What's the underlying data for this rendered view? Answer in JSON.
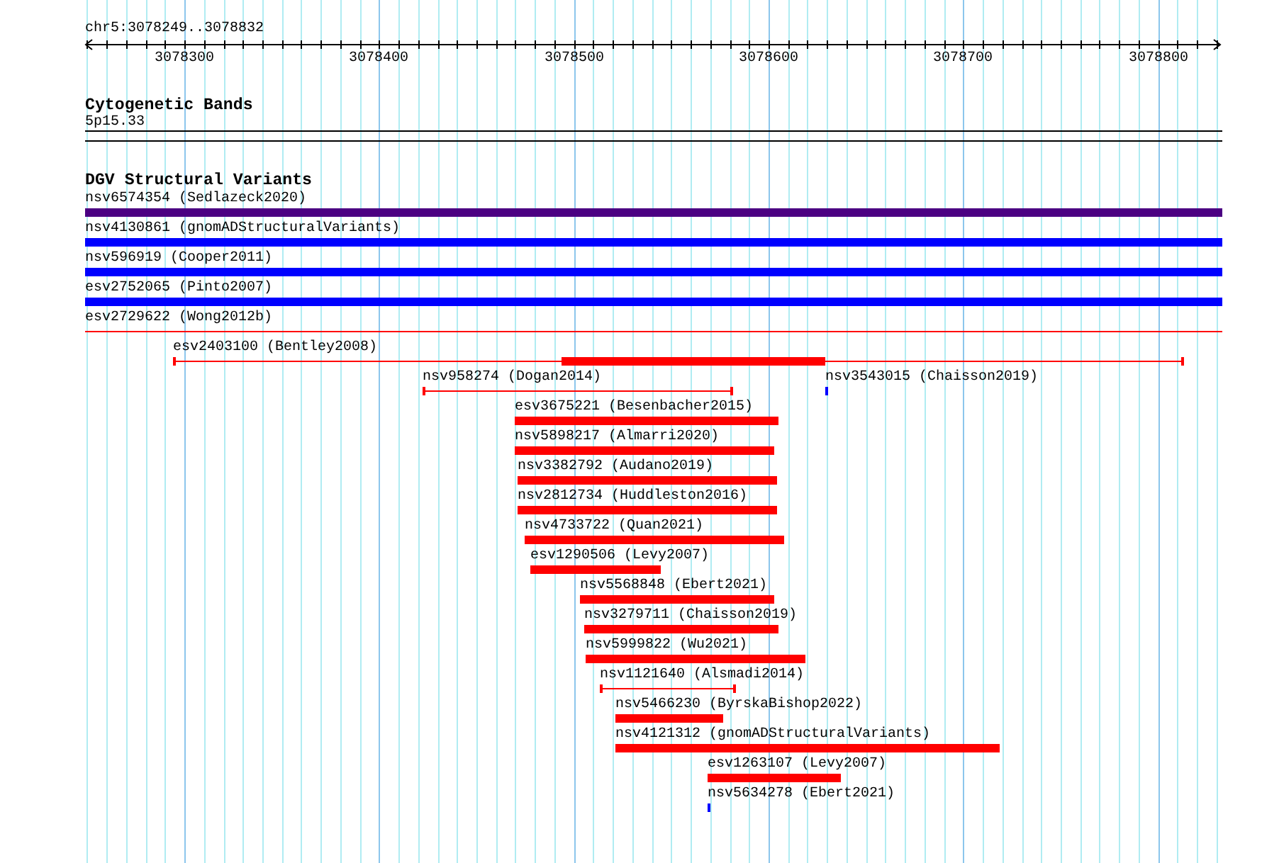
{
  "ruler": {
    "location": "chr5:3078249..3078832",
    "ticks": [
      "3078300",
      "3078400",
      "3078500",
      "3078600",
      "3078700",
      "3078800"
    ]
  },
  "tracks": [
    {
      "title": "Cytogenetic Bands",
      "kind": "bands",
      "bands": [
        {
          "label": "5p15.33"
        }
      ]
    },
    {
      "title": "DGV Structural Variants",
      "kind": "features",
      "rows": [
        {
          "features": [
            {
              "label": "nsv6574354 (Sedlazeck2020)",
              "kind": "bar",
              "color": "#4b0082"
            }
          ]
        },
        {
          "features": [
            {
              "label": "nsv4130861 (gnomADStructuralVariants)",
              "kind": "bar",
              "color": "#0000ff"
            }
          ]
        },
        {
          "features": [
            {
              "label": "nsv596919 (Cooper2011)",
              "kind": "bar",
              "color": "#0000ff"
            }
          ]
        },
        {
          "features": [
            {
              "label": "esv2752065 (Pinto2007)",
              "kind": "bar",
              "color": "#0000ff"
            }
          ]
        },
        {
          "features": [
            {
              "label": "esv2729622 (Wong2012b)",
              "kind": "line",
              "color": "#ff0000"
            }
          ]
        },
        {
          "features": [
            {
              "label": "esv2403100 (Bentley2008)",
              "kind": "hybrid",
              "color": "#ff0000"
            }
          ]
        },
        {
          "features": [
            {
              "label": "nsv958274 (Dogan2014)",
              "kind": "line",
              "color": "#ff0000"
            },
            {
              "label": "nsv3543015 (Chaisson2019)",
              "kind": "bar",
              "color": "#0000ff"
            }
          ]
        },
        {
          "features": [
            {
              "label": "esv3675221 (Besenbacher2015)",
              "kind": "bar",
              "color": "#ff0000"
            }
          ]
        },
        {
          "features": [
            {
              "label": "nsv5898217 (Almarri2020)",
              "kind": "bar",
              "color": "#ff0000"
            }
          ]
        },
        {
          "features": [
            {
              "label": "nsv3382792 (Audano2019)",
              "kind": "bar",
              "color": "#ff0000"
            }
          ]
        },
        {
          "features": [
            {
              "label": "nsv2812734 (Huddleston2016)",
              "kind": "bar",
              "color": "#ff0000"
            }
          ]
        },
        {
          "features": [
            {
              "label": "nsv4733722 (Quan2021)",
              "kind": "bar",
              "color": "#ff0000"
            }
          ]
        },
        {
          "features": [
            {
              "label": "esv1290506 (Levy2007)",
              "kind": "bar",
              "color": "#ff0000"
            }
          ]
        },
        {
          "features": [
            {
              "label": "nsv5568848 (Ebert2021)",
              "kind": "bar",
              "color": "#ff0000"
            }
          ]
        },
        {
          "features": [
            {
              "label": "nsv3279711 (Chaisson2019)",
              "kind": "bar",
              "color": "#ff0000"
            }
          ]
        },
        {
          "features": [
            {
              "label": "nsv5999822 (Wu2021)",
              "kind": "bar",
              "color": "#ff0000"
            }
          ]
        },
        {
          "features": [
            {
              "label": "nsv1121640 (Alsmadi2014)",
              "kind": "line",
              "color": "#ff0000"
            }
          ]
        },
        {
          "features": [
            {
              "label": "nsv5466230 (ByrskaBishop2022)",
              "kind": "bar",
              "color": "#ff0000"
            }
          ]
        },
        {
          "features": [
            {
              "label": "nsv4121312 (gnomADStructuralVariants)",
              "kind": "bar",
              "color": "#ff0000"
            }
          ]
        },
        {
          "features": [
            {
              "label": "esv1263107 (Levy2007)",
              "kind": "bar",
              "color": "#ff0000"
            }
          ]
        },
        {
          "features": [
            {
              "label": "nsv5634278 (Ebert2021)",
              "kind": "bar",
              "color": "#0000ff"
            }
          ]
        }
      ]
    }
  ]
}
